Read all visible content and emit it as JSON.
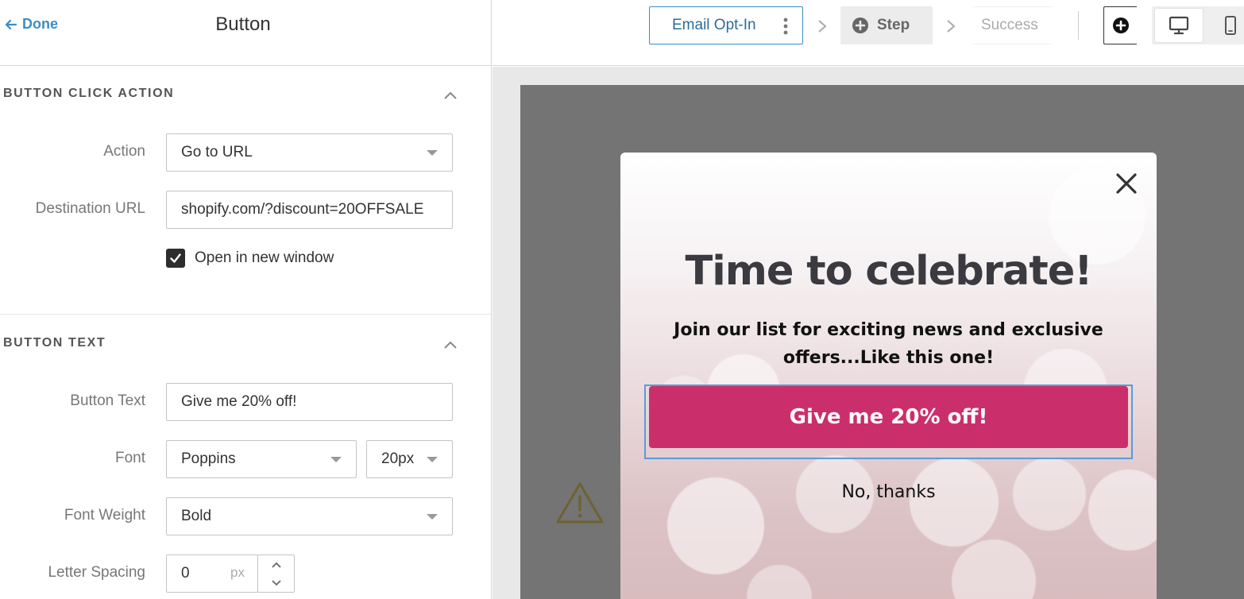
{
  "panel": {
    "back_label": "Done",
    "title": "Button"
  },
  "sections": {
    "click_action": {
      "title": "BUTTON CLICK ACTION",
      "action_label": "Action",
      "action_value": "Go to URL",
      "url_label": "Destination URL",
      "url_value": "shopify.com/?discount=20OFFSALE",
      "open_new_window_label": "Open in new window",
      "open_new_window_checked": true
    },
    "button_text": {
      "title": "BUTTON TEXT",
      "text_label": "Button Text",
      "text_value": "Give me 20% off!",
      "font_label": "Font",
      "font_value": "Poppins",
      "font_size_value": "20px",
      "weight_label": "Font Weight",
      "weight_value": "Bold",
      "spacing_label": "Letter Spacing",
      "spacing_value": "0",
      "spacing_unit": "px"
    }
  },
  "topbar": {
    "steps": [
      "Email Opt-In",
      "Step",
      "Success"
    ],
    "icons": [
      "more-vertical-icon",
      "plus-circle-icon",
      "desktop-icon",
      "mobile-icon"
    ]
  },
  "popup": {
    "title": "Time to celebrate!",
    "subtitle": "Join our list for exciting news and exclusive offers...Like this one!",
    "cta_label": "Give me 20% off!",
    "decline_label": "No, thanks"
  },
  "colors": {
    "accent_blue": "#3a8ec4",
    "cta_pink": "#cb2f6b",
    "stage_gray": "#747474",
    "warning_olive": "#6e6230"
  }
}
